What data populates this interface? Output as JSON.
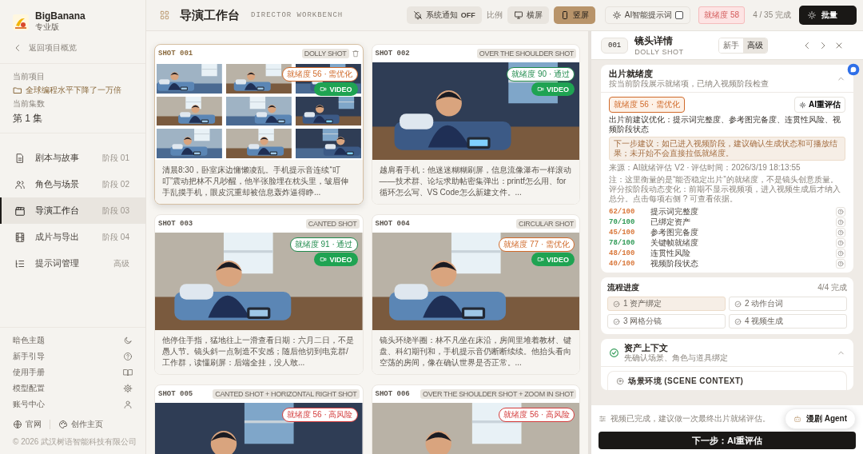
{
  "sidebar": {
    "brand": "BigBanana",
    "edition": "专业版",
    "back_link": "返回项目概览",
    "project_label": "当前项目",
    "project": "全球编程水平下降了一万倍",
    "episode_label": "当前集数",
    "episode": "第 1 集",
    "nav": [
      {
        "label": "剧本与故事",
        "stage": "阶段 01",
        "selected": false
      },
      {
        "label": "角色与场景",
        "stage": "阶段 02",
        "selected": false
      },
      {
        "label": "导演工作台",
        "stage": "阶段 03",
        "selected": true
      },
      {
        "label": "成片与导出",
        "stage": "阶段 04",
        "selected": false
      },
      {
        "label": "提示词管理",
        "stage": "高级",
        "selected": false
      }
    ],
    "settings": [
      "暗色主题",
      "新手引导",
      "使用手册",
      "模型配置",
      "账号中心"
    ],
    "links": [
      "官网",
      "创作主页"
    ],
    "copyright": "© 2026 武汉树语智能科技有限公司"
  },
  "header": {
    "title": "导演工作台",
    "subtitle": "DIRECTOR WORKBENCH",
    "notification": {
      "label": "系统通知",
      "state": "OFF"
    },
    "ratio_label": "比例",
    "ratios": [
      {
        "label": "横屏",
        "selected": false
      },
      {
        "label": "竖屏",
        "selected": true
      }
    ],
    "ai_prompt": {
      "label": "AI智能提示词",
      "checked": false
    },
    "readiness": "就绪度 58",
    "progress": "4 / 35 完成",
    "batch_button": "批量"
  },
  "shots": [
    {
      "number": "SHOT 001",
      "tag": "DOLLY SHOT",
      "selected": true,
      "kind": "storyboard",
      "readiness": "就绪度 56 · 需优化",
      "color": "#d06a2a",
      "video": "VIDEO",
      "description": "清晨8:30，卧室床边慵懒凌乱。手机提示音连续“叮叮”震动把林不凡吵醒，他半张脸埋在枕头里，皱眉伸手乱摸手机，眼皮沉重却被信息轰炸逼得睁..."
    },
    {
      "number": "SHOT 002",
      "tag": "OVER THE SHOULDER SHOT",
      "selected": false,
      "kind": "still",
      "readiness": "就绪度 90 · 通过",
      "color": "#1f8a4c",
      "video": "VIDEO",
      "description": "越肩看手机：他迷迷糊糊刷屏，信息流像瀑布一样滚动——技术群、论坛求助帖密集弹出：printf怎么用、for循环怎么写、VS Code怎么新建文件。..."
    },
    {
      "number": "SHOT 003",
      "tag": "CANTED SHOT",
      "selected": false,
      "kind": "still",
      "readiness": "就绪度 91 · 通过",
      "color": "#1f8a4c",
      "video": "VIDEO",
      "description": "他停住手指，猛地往上一滑查看日期：六月二日，不是愚人节。镜头斜一点制造不安感；随后他切到电竞群/工作群，读懂刷屏：后端全挂，没人敢..."
    },
    {
      "number": "SHOT 004",
      "tag": "CIRCULAR SHOT",
      "selected": false,
      "kind": "still",
      "readiness": "就绪度 77 · 需优化",
      "color": "#d06a2a",
      "video": "VIDEO",
      "description": "镜头环绕半圈：林不凡坐在床沿，房间里堆着教材、键盘、科幻期刊和，手机提示音仍断断续续。他抬头看向空荡的房间，像在确认世界是否正常。..."
    },
    {
      "number": "SHOT 005",
      "tag": "CANTED SHOT + HORIZONTAL RIGHT SHOT",
      "selected": false,
      "kind": "still",
      "readiness": "就绪度 56 · 高风险",
      "color": "#d33b3b"
    },
    {
      "number": "SHOT 006",
      "tag": "OVER THE SHOULDER SHOT + ZOOM IN SHOT",
      "selected": false,
      "kind": "still",
      "readiness": "就绪度 56 · 高风险",
      "color": "#d33b3b"
    }
  ],
  "detail": {
    "number": "001",
    "title": "镜头详情",
    "subtitle": "DOLLY SHOT",
    "modes": [
      {
        "label": "新手",
        "selected": false
      },
      {
        "label": "高级",
        "selected": true
      }
    ],
    "readiness_card": {
      "title": "出片就绪度",
      "subtitle": "按当前阶段展示就绪项，已纳入视频阶段检查",
      "expanded": true,
      "badge": "就绪度 56 · 需优化",
      "color": "#d06a2a",
      "reassess": "AI重评估",
      "summary": "出片前建议优化：提示词完整度、参考图完备度、连贯性风险、视频阶段状态",
      "suggestion": "下一步建议：如已进入视频阶段，建议确认生成状态和可播放结果；未开始不会直接拉低就绪度。",
      "source": "来源：AI就绪评估 V2 · 评估时间：2026/3/19 18:13:55",
      "note": "注：这里衡量的是“能否稳定出片”的就绪度，不是镜头创意质量。评分按阶段动态变化：前期不显示视频项，进入视频生成后才纳入总分。点击每项右侧 ? 可查看依据。",
      "scores": [
        {
          "score": "62/100",
          "label": "提示词完整度",
          "color": "#d9773a"
        },
        {
          "score": "70/100",
          "label": "已绑定资产",
          "color": "#2f9a56"
        },
        {
          "score": "45/100",
          "label": "参考图完备度",
          "color": "#d9773a"
        },
        {
          "score": "78/100",
          "label": "关键帧就绪度",
          "color": "#2f9a56"
        },
        {
          "score": "48/100",
          "label": "连贯性风险",
          "color": "#d9773a"
        },
        {
          "score": "40/100",
          "label": "视频阶段状态",
          "color": "#d9773a"
        }
      ]
    },
    "workflow": {
      "title": "流程进度",
      "count": "4/4 完成",
      "steps": [
        {
          "label": "1 资产绑定",
          "selected": true
        },
        {
          "label": "2 动作台词",
          "selected": false
        },
        {
          "label": "3 网格分镜",
          "selected": false
        },
        {
          "label": "4 视频生成",
          "selected": false
        }
      ]
    },
    "assets": {
      "title": "资产上下文",
      "subtitle": "先确认场景、角色与道具绑定",
      "expanded": true,
      "scene_title": "场景环境 (SCENE CONTEXT)"
    },
    "footer": {
      "hint": "视频已完成，建议做一次最终出片就绪评估。",
      "next_button": "下一步：AI重评估"
    },
    "agent_button": "漫剧 Agent"
  }
}
